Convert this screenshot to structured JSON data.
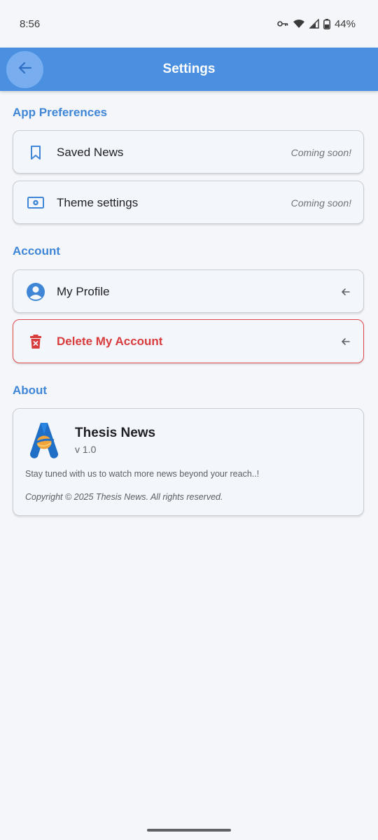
{
  "status_bar": {
    "time": "8:56",
    "battery": "44%"
  },
  "appbar": {
    "title": "Settings"
  },
  "sections": {
    "preferences": "App Preferences",
    "account": "Account",
    "about": "About"
  },
  "preferences": {
    "saved_news": {
      "label": "Saved News",
      "trail": "Coming soon!"
    },
    "theme": {
      "label": "Theme settings",
      "trail": "Coming soon!"
    }
  },
  "account": {
    "profile": {
      "label": "My Profile"
    },
    "delete": {
      "label": "Delete My Account"
    }
  },
  "about": {
    "app_name": "Thesis News",
    "version": "v 1.0",
    "description": "Stay tuned with us to watch more news beyond your reach..!",
    "copyright": "Copyright © 2025 Thesis News. All rights reserved."
  },
  "colors": {
    "primary": "#4a8fe0",
    "section": "#3f86d6",
    "danger": "#d93c3c",
    "background": "#f4f6fa"
  }
}
